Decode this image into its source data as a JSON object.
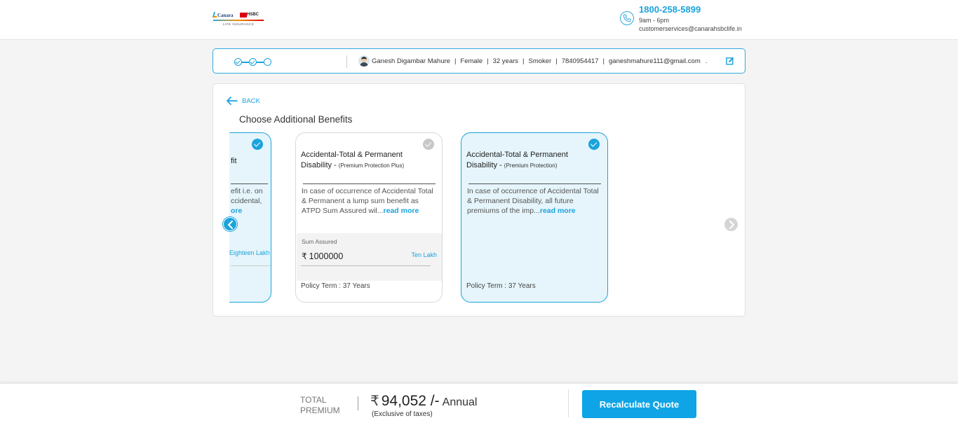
{
  "header": {
    "logo": {
      "brand_left": "Canara",
      "brand_right": "HSBC",
      "tagline": "LIFE INSURANCE"
    },
    "contact": {
      "phone": "1800-258-5899",
      "hours": "9am - 6pm",
      "email": "customerservices@canarahsbclife.in"
    }
  },
  "progress": {
    "steps_total": 3,
    "steps_completed": 2
  },
  "user": {
    "name": "Ganesh Digambar Mahure",
    "gender": "Female",
    "age": "32 years",
    "smoker": "Smoker",
    "phone": "7840954417",
    "email": "ganeshmahure111@gmail.com",
    "trailing": "."
  },
  "main": {
    "back_label": "BACK",
    "title": "Choose Additional Benefits"
  },
  "cards": [
    {
      "title_visible": "fit",
      "desc_line1": "efit i.e. on",
      "desc_line2": "ccidental,",
      "desc_more": "ore",
      "sum_assured_words": "Eighteen Lakh",
      "selected": true
    },
    {
      "title": "Accidental-Total & Permanent Disability -",
      "tag": "(Premium Protection Plus)",
      "description": "In case of occurrence of Accidental Total & Permanent a lump sum benefit as ATPD Sum Assured wil...",
      "read_more": "read more",
      "sum_assured_label": "Sum Assured",
      "currency_symbol": "₹",
      "sum_assured_value": "1000000",
      "sum_assured_words": "Ten Lakh",
      "policy_term": "Policy Term : 37 Years",
      "selected": false
    },
    {
      "title": "Accidental-Total & Permanent Disability -",
      "tag": "(Premium Protection)",
      "description": "In case of occurrence of Accidental Total & Permanent Disability, all future premiums of the imp...",
      "read_more": "read more",
      "policy_term": "Policy Term : 37 Years",
      "selected": true
    }
  ],
  "footer": {
    "total_label_line1": "TOTAL",
    "total_label_line2": "PREMIUM",
    "currency_symbol": "₹",
    "amount": "94,052 /-",
    "period": "Annual",
    "note": "(Exclusive of taxes)",
    "button_label": "Recalculate Quote"
  },
  "colors": {
    "accent": "#1ba3dd",
    "selected_bg": "#e5f5fb",
    "button_bg": "#0fa4e6"
  }
}
